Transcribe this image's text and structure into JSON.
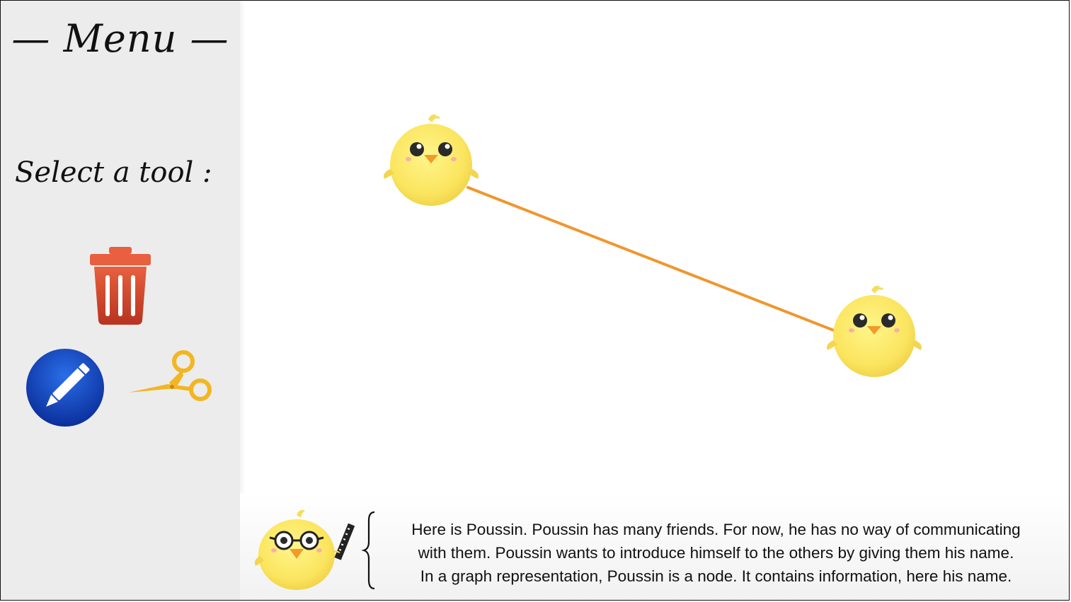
{
  "sidebar": {
    "title": "— Menu —",
    "select_label": "Select a tool :",
    "tools": [
      {
        "name": "delete",
        "icon": "trash-icon",
        "color": "#d9533c"
      },
      {
        "name": "draw",
        "icon": "pencil-icon",
        "color": "#1a4fc0"
      },
      {
        "name": "cut",
        "icon": "scissors-icon",
        "color": "#f3b623"
      }
    ]
  },
  "canvas": {
    "nodes": [
      {
        "icon": "chick-icon"
      },
      {
        "icon": "chick-icon"
      }
    ],
    "edge_color": "#f0962e"
  },
  "info": {
    "icon": "professor-chick-icon",
    "lines": [
      "Here is Poussin. Poussin has many friends. For now, he has no way of communicating",
      "with them. Poussin wants to introduce himself to the others by giving them his name.",
      "In a graph representation, Poussin is a node. It contains information, here his name."
    ]
  }
}
